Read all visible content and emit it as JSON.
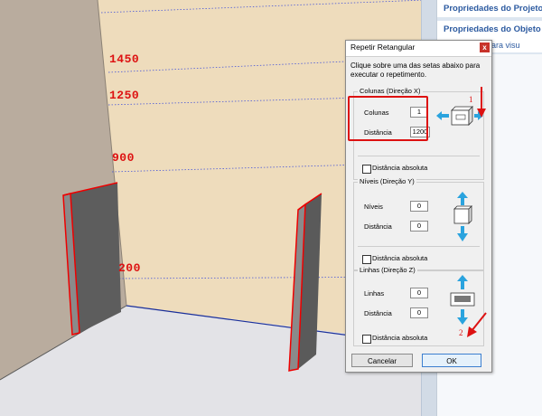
{
  "scene": {
    "dimension_labels": [
      "1450",
      "1250",
      "900",
      "200"
    ]
  },
  "side_panel": {
    "project_props": "Propriedades do Projeto",
    "object_props": "Propriedades do Objeto",
    "object_props_sub": "Objeto para visu"
  },
  "dialog": {
    "title": "Repetir Retangular",
    "close_label": "x",
    "instruction": "Clique sobre uma das setas abaixo para executar o repetimento.",
    "columns": {
      "legend": "Colunas (Direção X)",
      "count_label": "Colunas",
      "count_value": "1",
      "distance_label": "Distância",
      "distance_value": "1200",
      "absolute_label": "Distância absoluta"
    },
    "levels": {
      "legend": "Níveis (Direção Y)",
      "count_label": "Níveis",
      "count_value": "0",
      "distance_label": "Distância",
      "distance_value": "0",
      "absolute_label": "Distância absoluta"
    },
    "lines": {
      "legend": "Linhas (Direção Z)",
      "count_label": "Linhas",
      "count_value": "0",
      "distance_label": "Distância",
      "distance_value": "0",
      "absolute_label": "Distância absoluta"
    },
    "cancel_label": "Cancelar",
    "ok_label": "OK"
  },
  "annotations": {
    "step1": "1",
    "step2": "2"
  },
  "colors": {
    "annotation_red": "#dd1111",
    "arrow_cyan": "#2aa3de",
    "panel_blue": "#2c5aa0"
  }
}
